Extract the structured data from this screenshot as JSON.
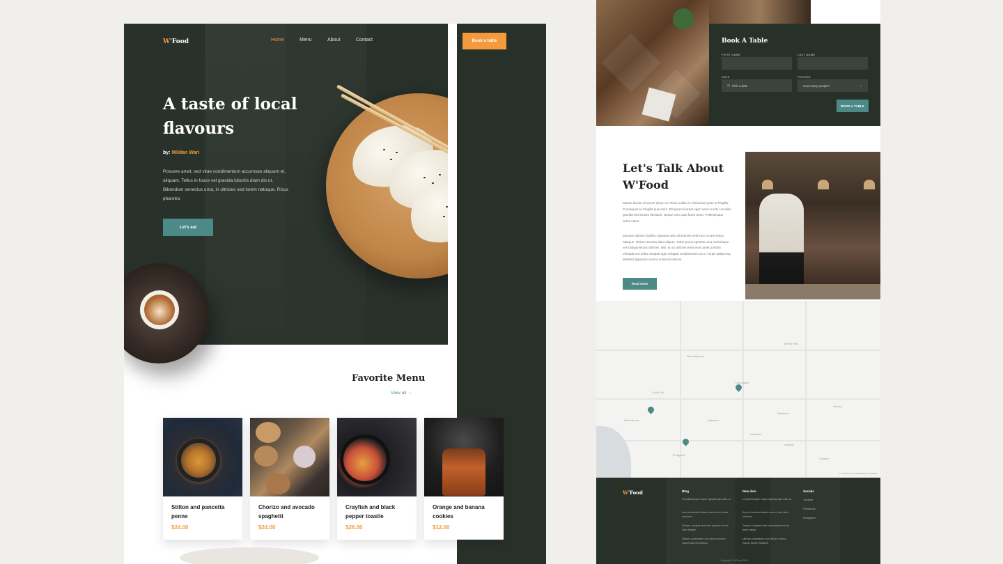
{
  "left": {
    "logo": {
      "w": "W",
      "rest": "'Food"
    },
    "nav": [
      {
        "label": "Home",
        "active": true
      },
      {
        "label": "Menu",
        "active": false
      },
      {
        "label": "About",
        "active": false
      },
      {
        "label": "Contact",
        "active": false
      }
    ],
    "book_button": "Book a table",
    "hero": {
      "title": "A taste of local flavours",
      "by_label": "by:",
      "author": "Wildan Wari",
      "description": "Posuere amet, sed vitae condimentum accumsan aliquam et, aliquam. Tellus in fusce vel gravida lobortis diam dis ut. Bibendum senectus urna, in ultricies sed lorem natoque. Risus pharetra",
      "cta": "Let's eat"
    },
    "favorite": {
      "title": "Favorite Menu",
      "view_all": "View all →"
    },
    "menu_items": [
      {
        "name": "Stilton and pancetta penne",
        "price": "$24.00"
      },
      {
        "name": "Chorizo and avocado spaghetti",
        "price": "$24.00"
      },
      {
        "name": "Crayfish and black pepper toastie",
        "price": "$26.00"
      },
      {
        "name": "Orange and banana cookies",
        "price": "$12.00"
      }
    ]
  },
  "right": {
    "booking": {
      "title": "Book A Table",
      "first_name_label": "FIRST NAME",
      "last_name_label": "LAST NAME",
      "date_label": "DATE",
      "person_label": "PERSON",
      "date_placeholder": "Pick a date",
      "person_placeholder": "How many people?",
      "submit": "BOOK A TABLE"
    },
    "about": {
      "title": "Let's Talk About W'Food",
      "para1": "Mauris lacinia sit ipsum ipsum ut. Risus nullam in elit laoreet justo et fringilla. Consequat eu fringilla quis enim. Elit ipsum laoreet eget metus morbi convallis gravida elementum tincidunt. Neque enim quis fusce amet. Pellentesque netus netus.",
      "para2": "posuere ultrices facilisis. Egestas sed, elit lobortis velit eros ornare lectus natoque. Dictum aenean diam aliquet. Tortor purus egestas urna scelerisque vel tristique lectus ultricies. Nisi, eu ut ultricies enim enim amet porttitor. Volutpat orci tellus volutpat eget volutpat condimentum ac a. Turpis adipiscing eleifend dignissim viverra euismod ultrices.",
      "cta": "Read more"
    },
    "map": {
      "labels": [
        "Beverly Hills",
        "West Hollywood",
        "Los Angeles",
        "Inglewood",
        "Culver City",
        "Santa Monica",
        "Hawthorne",
        "Gardena",
        "Downey",
        "Compton",
        "Westmont",
        "El Segundo"
      ],
      "credit": "© Leaflet | © OpenStreetMap contributors"
    },
    "footer": {
      "logo": {
        "w": "W",
        "rest": "'Food"
      },
      "blog_head": "Blog",
      "blog_items": [
        "Ut pellentesque neque egestas quis odio, at",
        "Arcu et tincidunt dictum nunc ut nisl, dolor euismod",
        "Tempor, volutpat nulla sed posuere orci at diam integer",
        "Ultrices consectetur orci ultrices viverra mauris laoreet tincidunt"
      ],
      "news_head": "New item",
      "news_items": [
        "Ut pellentesque neque egestas quis odio, at",
        "Arcu et tincidunt dictum nunc ut nisl, dolor euismod",
        "Tempor, volutpat nulla sed posuere orci at diam integer",
        "Ultrices consectetur orci ultrices viverra mauris laoreet tincidunt"
      ],
      "socials_head": "Socials",
      "socials": [
        "Youtube",
        "Facebook",
        "Instagram"
      ],
      "copyright": "Copyright © W'Food 2021"
    }
  },
  "colors": {
    "dark_green": "#29312b",
    "accent_orange": "#f39a3c",
    "accent_teal": "#4b8a86",
    "background": "#f1efec"
  }
}
